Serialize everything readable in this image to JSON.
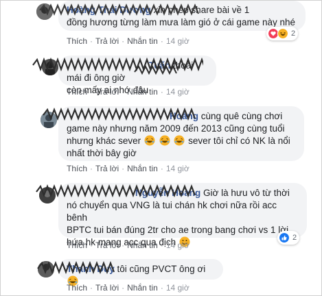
{
  "colors": {
    "bubble": "#f2f3f5",
    "author": "#385898",
    "action": "#606770",
    "heart": "#f33e58",
    "like": "#1877f2",
    "haha": "#f7b125"
  },
  "actions": {
    "like": "Thích",
    "reply": "Trả lời",
    "message": "Nhắn tin",
    "sep": "·"
  },
  "comments": [
    {
      "author": "Hoàng Thái Dương",
      "line1": "xin phép share bài về 1",
      "line2": "đồng hương từng làm mưa làm gió ở cái game này nhé",
      "time": "14 giờ",
      "reactions": {
        "icons": [
          "heart-icon",
          "haha-icon"
        ],
        "count": "2"
      }
    },
    {
      "author": "Tuấn",
      "line1": "thoải mái đi ông giờ",
      "line2": "còn mấy ai nhớ đâu",
      "time": "14 giờ"
    },
    {
      "author": "Hoàng",
      "line1": "cùng quê cùng chơi",
      "line2": "game này nhưng năm 2009 đến 2013 cũng cùng tuổi",
      "line3a": "nhưng khác sever",
      "line3b": "sever tôi chỉ có NK là nổi",
      "line4": "nhất thời bây giờ",
      "time": "14 giờ"
    },
    {
      "author": "Nguyễn Hoàng",
      "line1": "Giờ là hưu vô từ thời",
      "line2": "nó chuyển qua VNG là tui chán hk chơi nữa rồi acc bênh",
      "line3": "BPTC tui bán đúng 2tr cho ae trong bang chơi vs 1 lời",
      "line4": "hứa hk mang acc qua địch",
      "time": "14 giờ",
      "reactions": {
        "icons": [
          "like-icon"
        ],
        "count": "2"
      }
    },
    {
      "author": "Thanh Duy",
      "line1": "tôi cũng PVCT ông ơi",
      "time": "14 giờ"
    }
  ]
}
